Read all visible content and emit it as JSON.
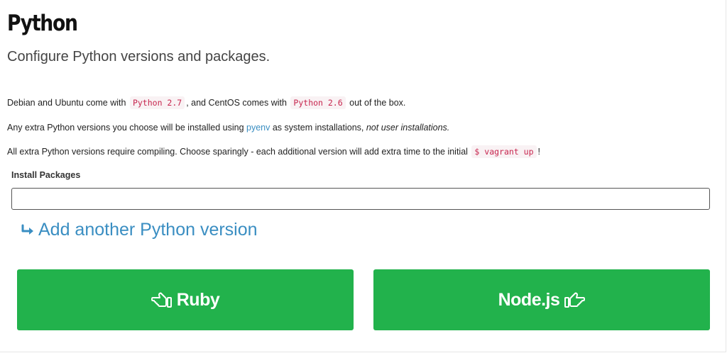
{
  "header": {
    "title": "Python",
    "subtitle": "Configure Python versions and packages."
  },
  "intro": {
    "p1_a": "Debian and Ubuntu come with",
    "p1_code1": "Python 2.7",
    "p1_b": ", and CentOS comes with",
    "p1_code2": "Python 2.6",
    "p1_c": "out of the box.",
    "p2_a": "Any extra Python versions you choose will be installed using",
    "p2_link": "pyenv",
    "p2_b": "as system installations,",
    "p2_em": "not user installations.",
    "p3_a": "All extra Python versions require compiling. Choose sparingly - each additional version will add extra time to the initial",
    "p3_code": "$ vagrant up",
    "p3_b": "!"
  },
  "packages": {
    "label": "Install Packages",
    "value": "",
    "placeholder": ""
  },
  "actions": {
    "add_version": "Add another Python version",
    "prev_label": "Ruby",
    "next_label": "Node.js"
  },
  "icons": {
    "add_version": "arrow-right-return-icon",
    "prev": "hand-point-left-icon",
    "next": "hand-point-right-icon"
  },
  "colors": {
    "accent_green": "#22b24c",
    "link_blue": "#3a8ec2",
    "code_red": "#c7254e"
  }
}
